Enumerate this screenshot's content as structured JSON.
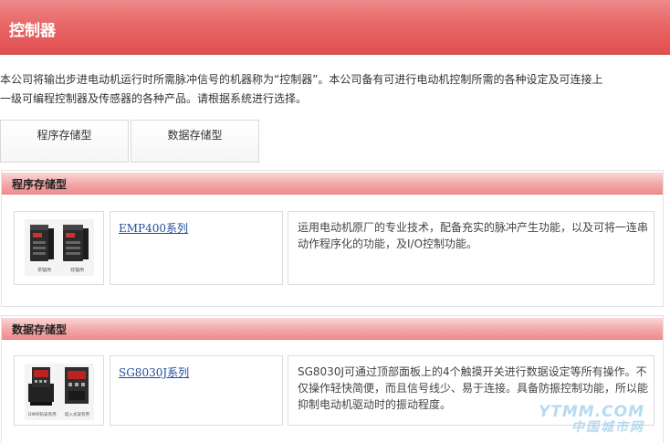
{
  "header": {
    "title": "控制器"
  },
  "intro": {
    "line1": "本公司将输出步进电动机运行时所需脉冲信号的机器称为“控制器”。本公司备有可进行电动机控制所需的各种设定及可连接上",
    "line2": "一级可编程控制器及传感器的各种产品。请根据系统进行选择。"
  },
  "tabs": [
    {
      "label": "程序存储型"
    },
    {
      "label": "数据存储型"
    }
  ],
  "sections": [
    {
      "title": "程序存储型",
      "product": {
        "name": "EMP400系列",
        "image_captions": [
          "单轴用",
          "双轴用"
        ],
        "description": "运用电动机原厂的专业技术，配备充实的脉冲产生功能，以及可将一连串动作程序化的功能，及I/O控制功能。"
      }
    },
    {
      "title": "数据存储型",
      "product": {
        "name": "SG8030J系列",
        "image_captions": [
          "DIN导轨安装用",
          "嵌入式安装用"
        ],
        "description": "SG8030J可通过顶部面板上的4个触摸开关进行数据设定等所有操作。不仅操作轻快简便，而且信号线少、易于连接。具备防振控制功能，所以能抑制电动机驱动时的振动程度。"
      }
    }
  ],
  "watermark": {
    "line1": "YTMM.COM",
    "line2": "中国城市网"
  },
  "colors": {
    "header": "#e96767",
    "section_header": "#f3a7a7",
    "link": "#1f4e99"
  }
}
